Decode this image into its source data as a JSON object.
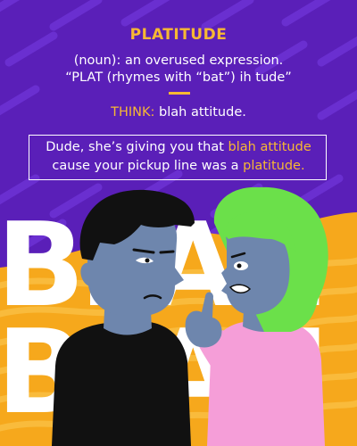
{
  "entry": {
    "word": "PLATITUDE",
    "definition_line1": "(noun): an overused expression.",
    "definition_line2": "“PLAT (rhymes with “bat”) ih tude”"
  },
  "think": {
    "label": "THINK:",
    "phrase": "blah attitude."
  },
  "example": {
    "line1_start": "Dude, she’s giving you that ",
    "line1_highlight": "blah attitude",
    "line2_start": "cause your pickup line was a ",
    "line2_highlight": "platitude."
  },
  "background": {
    "word_row1": "BLAH",
    "word_row2": "BLAH"
  },
  "colors": {
    "purple_background": "#5a1fb8",
    "orange_background": "#f6a81c",
    "accent_text": "#f7b833",
    "man_skin": "#6e86ad",
    "woman_hair": "#6be04a",
    "woman_top": "#f59ed8"
  }
}
